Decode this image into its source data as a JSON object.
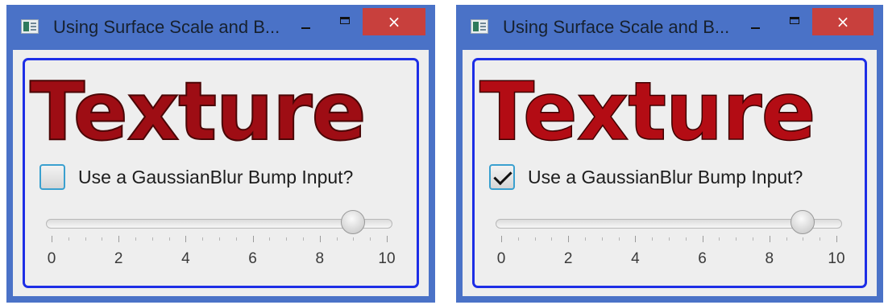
{
  "colors": {
    "window_frame": "#4a72c7",
    "close_button": "#c8403d",
    "focus_border": "#1d2ee6",
    "text_fill": "#9e0d14"
  },
  "windows": [
    {
      "title": "Using Surface Scale and B...",
      "icon": "app-window-icon",
      "controls": {
        "minimize": "minimize-icon",
        "maximize": "maximize-icon",
        "close": "×"
      },
      "texture_text": "Texture",
      "checkbox": {
        "label": "Use a GaussianBlur Bump Input?",
        "checked": false
      },
      "slider": {
        "value": 9,
        "min": 0,
        "max": 10,
        "tick_labels": [
          "0",
          "2",
          "4",
          "6",
          "8",
          "10"
        ]
      }
    },
    {
      "title": "Using Surface Scale and B...",
      "icon": "app-window-icon",
      "controls": {
        "minimize": "minimize-icon",
        "maximize": "maximize-icon",
        "close": "×"
      },
      "texture_text": "Texture",
      "checkbox": {
        "label": "Use a GaussianBlur Bump Input?",
        "checked": true
      },
      "slider": {
        "value": 9,
        "min": 0,
        "max": 10,
        "tick_labels": [
          "0",
          "2",
          "4",
          "6",
          "8",
          "10"
        ]
      }
    }
  ]
}
